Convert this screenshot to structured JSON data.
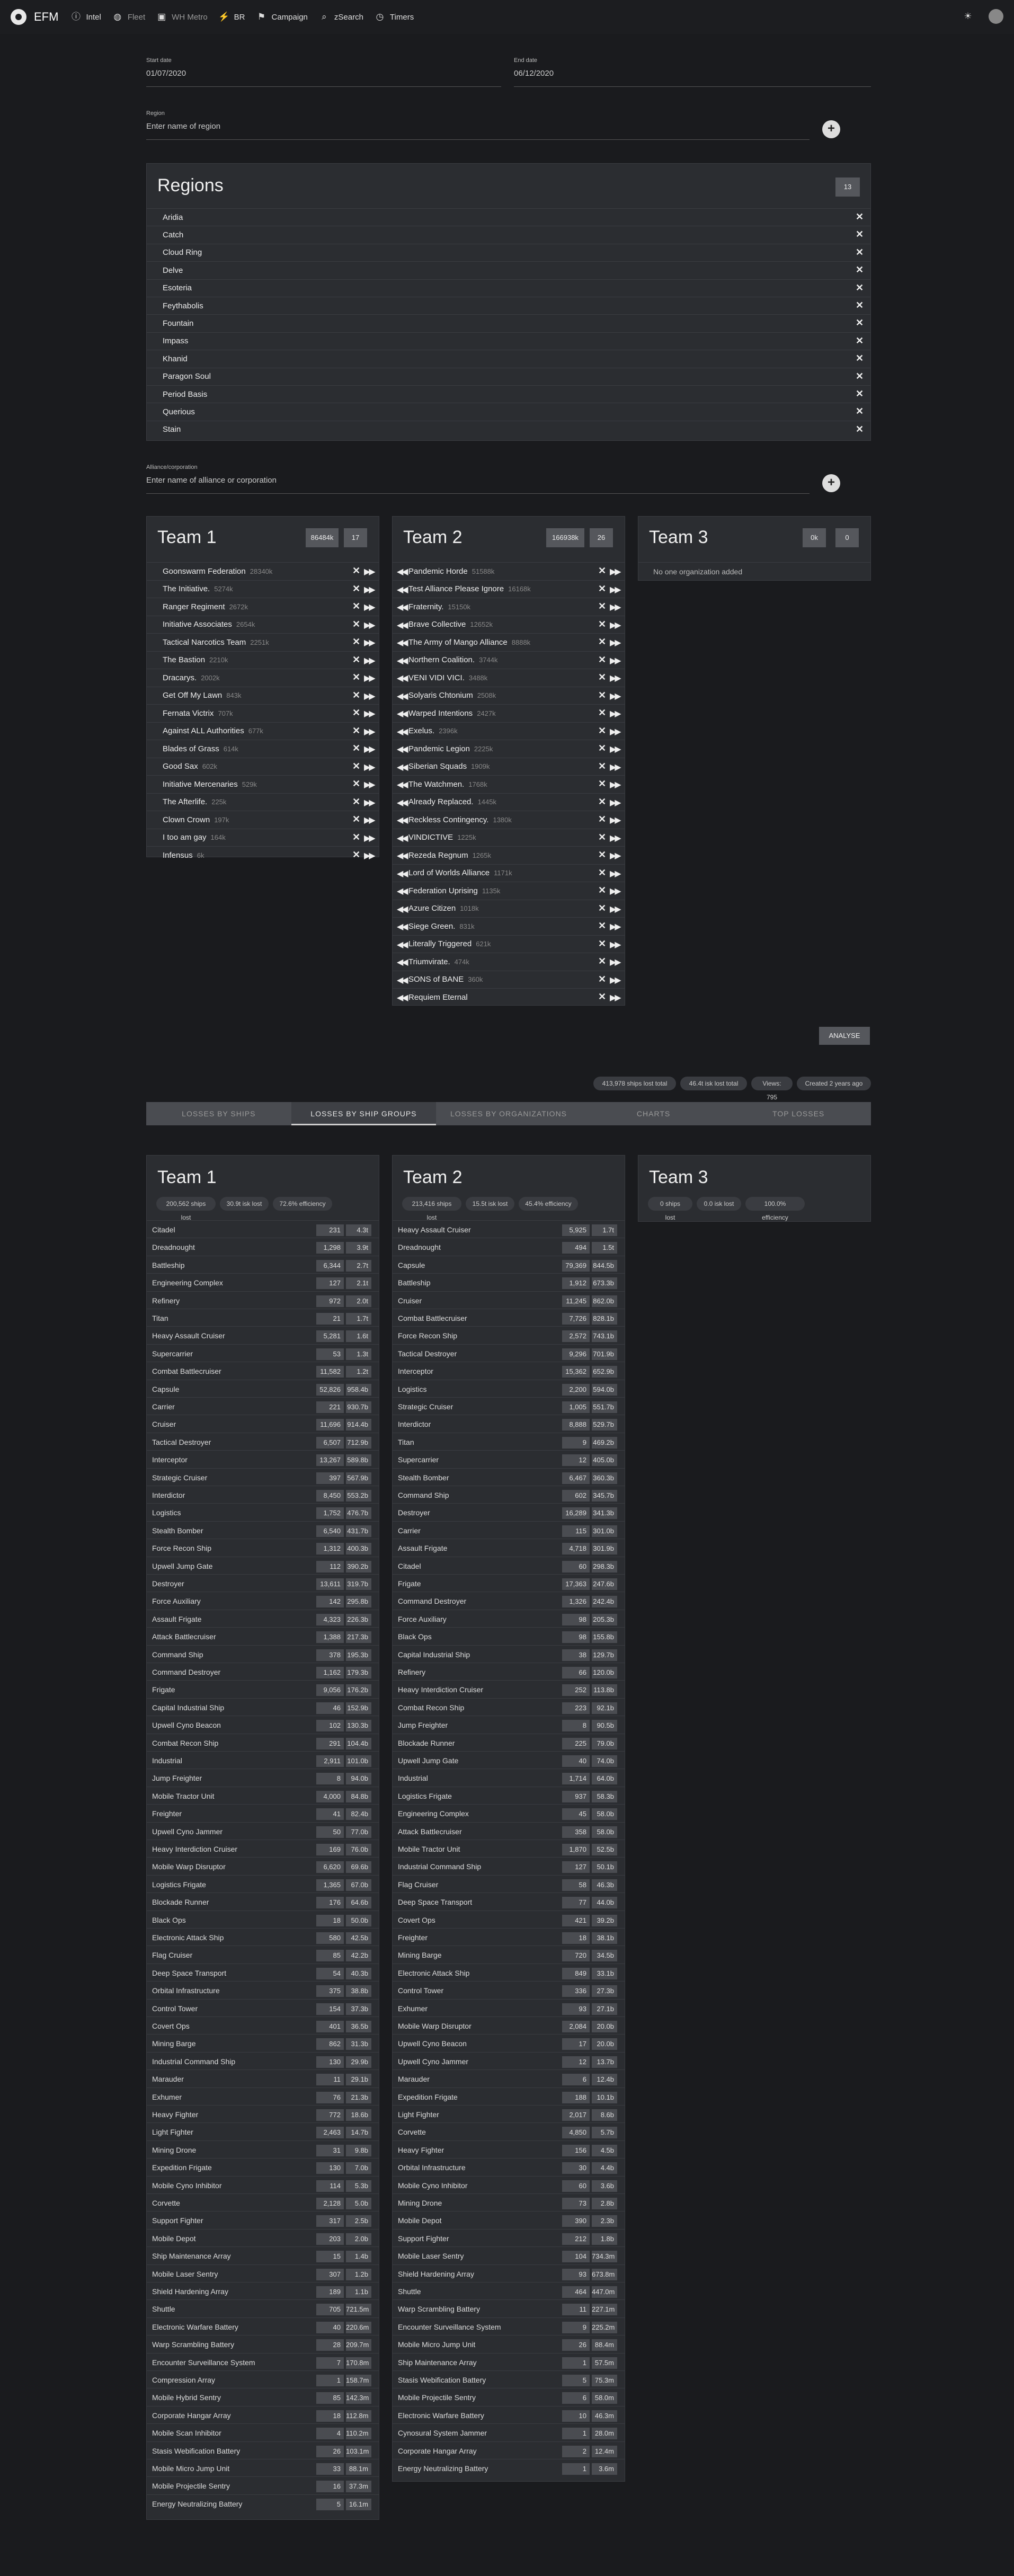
{
  "header": {
    "brand": "EFM",
    "nav": [
      {
        "icon": "info-icon",
        "label": "Intel"
      },
      {
        "icon": "globe-icon",
        "label": "Fleet"
      },
      {
        "icon": "metro-icon",
        "label": "WH Metro"
      },
      {
        "icon": "chart-icon",
        "label": "BR"
      },
      {
        "icon": "flag-icon",
        "label": "Campaign"
      },
      {
        "icon": "search-icon",
        "label": "zSearch"
      },
      {
        "icon": "clock-icon",
        "label": "Timers"
      }
    ]
  },
  "form": {
    "start_label": "Start date",
    "start_value": "01/07/2020",
    "end_label": "End date",
    "end_value": "06/12/2020",
    "region_label": "Region",
    "region_placeholder": "Enter name of region",
    "alliance_label": "Alliance/corporation",
    "alliance_placeholder": "Enter name of alliance or corporation"
  },
  "regions": {
    "title": "Regions",
    "count": "13",
    "items": [
      "Aridia",
      "Catch",
      "Cloud Ring",
      "Delve",
      "Esoteria",
      "Feythabolis",
      "Fountain",
      "Impass",
      "Khanid",
      "Paragon Soul",
      "Period Basis",
      "Querious",
      "Stain"
    ]
  },
  "teams": [
    {
      "title": "Team 1",
      "chip1": "86484k",
      "chip2": "17",
      "members": [
        [
          "Goonswarm Federation",
          "28340k"
        ],
        [
          "The Initiative.",
          "5274k"
        ],
        [
          "Ranger Regiment",
          "2672k"
        ],
        [
          "Initiative Associates",
          "2654k"
        ],
        [
          "Tactical Narcotics Team",
          "2251k"
        ],
        [
          "The Bastion",
          "2210k"
        ],
        [
          "Dracarys.",
          "2002k"
        ],
        [
          "Get Off My Lawn",
          "843k"
        ],
        [
          "Fernata Victrix",
          "707k"
        ],
        [
          "Against ALL Authorities",
          "677k"
        ],
        [
          "Blades of Grass",
          "614k"
        ],
        [
          "Good Sax",
          "602k"
        ],
        [
          "Initiative Mercenaries",
          "529k"
        ],
        [
          "The Afterlife.",
          "225k"
        ],
        [
          "Clown Crown",
          "197k"
        ],
        [
          "I too am gay",
          "164k"
        ],
        [
          "Infensus",
          "6k"
        ]
      ]
    },
    {
      "title": "Team 2",
      "chip1": "166938k",
      "chip2": "26",
      "members": [
        [
          "Pandemic Horde",
          "51588k"
        ],
        [
          "Test Alliance Please Ignore",
          "16168k"
        ],
        [
          "Fraternity.",
          "15150k"
        ],
        [
          "Brave Collective",
          "12652k"
        ],
        [
          "The Army of Mango Alliance",
          "8888k"
        ],
        [
          "Northern Coalition.",
          "3744k"
        ],
        [
          "VENI VIDI VICI.",
          "3488k"
        ],
        [
          "Solyaris Chtonium",
          "2508k"
        ],
        [
          "Warped Intentions",
          "2427k"
        ],
        [
          "Exelus.",
          "2396k"
        ],
        [
          "Pandemic Legion",
          "2225k"
        ],
        [
          "Siberian Squads",
          "1909k"
        ],
        [
          "The Watchmen.",
          "1768k"
        ],
        [
          "Already Replaced.",
          "1445k"
        ],
        [
          "Reckless Contingency.",
          "1380k"
        ],
        [
          "VINDICTIVE",
          "1225k"
        ],
        [
          "Rezeda Regnum",
          "1265k"
        ],
        [
          "Lord of Worlds Alliance",
          "1171k"
        ],
        [
          "Federation Uprising",
          "1135k"
        ],
        [
          "Azure Citizen",
          "1018k"
        ],
        [
          "Siege Green.",
          "831k"
        ],
        [
          "Literally Triggered",
          "621k"
        ],
        [
          "Triumvirate.",
          "474k"
        ],
        [
          "SONS of BANE",
          "360k"
        ],
        [
          "Requiem Eternal",
          ""
        ]
      ]
    },
    {
      "title": "Team 3",
      "chip1": "0k",
      "chip2": "0",
      "empty": "No one organization added"
    }
  ],
  "analyse_label": "ANALYSE",
  "stats": [
    "413,978 ships lost total",
    "46.4t isk lost total",
    "Views: 795",
    "Created 2 years ago"
  ],
  "tabs": [
    "LOSSES BY SHIPS",
    "LOSSES BY SHIP GROUPS",
    "LOSSES BY ORGANIZATIONS",
    "CHARTS",
    "TOP LOSSES"
  ],
  "losses": [
    {
      "title": "Team 1",
      "badges": [
        "200,562 ships lost",
        "30.9t isk lost",
        "72.6% efficiency"
      ],
      "rows": [
        [
          "Citadel",
          "231",
          "4.3t"
        ],
        [
          "Dreadnought",
          "1,298",
          "3.9t"
        ],
        [
          "Battleship",
          "6,344",
          "2.7t"
        ],
        [
          "Engineering Complex",
          "127",
          "2.1t"
        ],
        [
          "Refinery",
          "972",
          "2.0t"
        ],
        [
          "Titan",
          "21",
          "1.7t"
        ],
        [
          "Heavy Assault Cruiser",
          "5,281",
          "1.6t"
        ],
        [
          "Supercarrier",
          "53",
          "1.3t"
        ],
        [
          "Combat Battlecruiser",
          "11,582",
          "1.2t"
        ],
        [
          "Capsule",
          "52,826",
          "958.4b"
        ],
        [
          "Carrier",
          "221",
          "930.7b"
        ],
        [
          "Cruiser",
          "11,696",
          "914.4b"
        ],
        [
          "Tactical Destroyer",
          "6,507",
          "712.9b"
        ],
        [
          "Interceptor",
          "13,267",
          "589.8b"
        ],
        [
          "Strategic Cruiser",
          "397",
          "567.9b"
        ],
        [
          "Interdictor",
          "8,450",
          "553.2b"
        ],
        [
          "Logistics",
          "1,752",
          "476.7b"
        ],
        [
          "Stealth Bomber",
          "6,540",
          "431.7b"
        ],
        [
          "Force Recon Ship",
          "1,312",
          "400.3b"
        ],
        [
          "Upwell Jump Gate",
          "112",
          "390.2b"
        ],
        [
          "Destroyer",
          "13,611",
          "319.7b"
        ],
        [
          "Force Auxiliary",
          "142",
          "295.8b"
        ],
        [
          "Assault Frigate",
          "4,323",
          "226.3b"
        ],
        [
          "Attack Battlecruiser",
          "1,388",
          "217.3b"
        ],
        [
          "Command Ship",
          "378",
          "195.3b"
        ],
        [
          "Command Destroyer",
          "1,162",
          "179.3b"
        ],
        [
          "Frigate",
          "9,056",
          "176.2b"
        ],
        [
          "Capital Industrial Ship",
          "46",
          "152.9b"
        ],
        [
          "Upwell Cyno Beacon",
          "102",
          "130.3b"
        ],
        [
          "Combat Recon Ship",
          "291",
          "104.4b"
        ],
        [
          "Industrial",
          "2,911",
          "101.0b"
        ],
        [
          "Jump Freighter",
          "8",
          "94.0b"
        ],
        [
          "Mobile Tractor Unit",
          "4,000",
          "84.8b"
        ],
        [
          "Freighter",
          "41",
          "82.4b"
        ],
        [
          "Upwell Cyno Jammer",
          "50",
          "77.0b"
        ],
        [
          "Heavy Interdiction Cruiser",
          "169",
          "76.0b"
        ],
        [
          "Mobile Warp Disruptor",
          "6,620",
          "69.6b"
        ],
        [
          "Logistics Frigate",
          "1,365",
          "67.0b"
        ],
        [
          "Blockade Runner",
          "176",
          "64.6b"
        ],
        [
          "Black Ops",
          "18",
          "50.0b"
        ],
        [
          "Electronic Attack Ship",
          "580",
          "42.5b"
        ],
        [
          "Flag Cruiser",
          "85",
          "42.2b"
        ],
        [
          "Deep Space Transport",
          "54",
          "40.3b"
        ],
        [
          "Orbital Infrastructure",
          "375",
          "38.8b"
        ],
        [
          "Control Tower",
          "154",
          "37.3b"
        ],
        [
          "Covert Ops",
          "401",
          "36.5b"
        ],
        [
          "Mining Barge",
          "862",
          "31.3b"
        ],
        [
          "Industrial Command Ship",
          "130",
          "29.9b"
        ],
        [
          "Marauder",
          "11",
          "29.1b"
        ],
        [
          "Exhumer",
          "76",
          "21.3b"
        ],
        [
          "Heavy Fighter",
          "772",
          "18.6b"
        ],
        [
          "Light Fighter",
          "2,463",
          "14.7b"
        ],
        [
          "Mining Drone",
          "31",
          "9.8b"
        ],
        [
          "Expedition Frigate",
          "130",
          "7.0b"
        ],
        [
          "Mobile Cyno Inhibitor",
          "114",
          "5.3b"
        ],
        [
          "Corvette",
          "2,128",
          "5.0b"
        ],
        [
          "Support Fighter",
          "317",
          "2.5b"
        ],
        [
          "Mobile Depot",
          "203",
          "2.0b"
        ],
        [
          "Ship Maintenance Array",
          "15",
          "1.4b"
        ],
        [
          "Mobile Laser Sentry",
          "307",
          "1.2b"
        ],
        [
          "Shield Hardening Array",
          "189",
          "1.1b"
        ],
        [
          "Shuttle",
          "705",
          "721.5m"
        ],
        [
          "Electronic Warfare Battery",
          "40",
          "220.6m"
        ],
        [
          "Warp Scrambling Battery",
          "28",
          "209.7m"
        ],
        [
          "Encounter Surveillance System",
          "7",
          "170.8m"
        ],
        [
          "Compression Array",
          "1",
          "158.7m"
        ],
        [
          "Mobile Hybrid Sentry",
          "85",
          "142.3m"
        ],
        [
          "Corporate Hangar Array",
          "18",
          "112.8m"
        ],
        [
          "Mobile Scan Inhibitor",
          "4",
          "110.2m"
        ],
        [
          "Stasis Webification Battery",
          "26",
          "103.1m"
        ],
        [
          "Mobile Micro Jump Unit",
          "33",
          "88.1m"
        ],
        [
          "Mobile Projectile Sentry",
          "16",
          "37.3m"
        ],
        [
          "Energy Neutralizing Battery",
          "5",
          "16.1m"
        ]
      ]
    },
    {
      "title": "Team 2",
      "badges": [
        "213,416 ships lost",
        "15.5t isk lost",
        "45.4% efficiency"
      ],
      "rows": [
        [
          "Heavy Assault Cruiser",
          "5,925",
          "1.7t"
        ],
        [
          "Dreadnought",
          "494",
          "1.5t"
        ],
        [
          "Capsule",
          "79,369",
          "844.5b"
        ],
        [
          "Battleship",
          "1,912",
          "673.3b"
        ],
        [
          "Cruiser",
          "11,245",
          "862.0b"
        ],
        [
          "Combat Battlecruiser",
          "7,726",
          "828.1b"
        ],
        [
          "Force Recon Ship",
          "2,572",
          "743.1b"
        ],
        [
          "Tactical Destroyer",
          "9,296",
          "701.9b"
        ],
        [
          "Interceptor",
          "15,362",
          "652.9b"
        ],
        [
          "Logistics",
          "2,200",
          "594.0b"
        ],
        [
          "Strategic Cruiser",
          "1,005",
          "551.7b"
        ],
        [
          "Interdictor",
          "8,888",
          "529.7b"
        ],
        [
          "Titan",
          "9",
          "469.2b"
        ],
        [
          "Supercarrier",
          "12",
          "405.0b"
        ],
        [
          "Stealth Bomber",
          "6,467",
          "360.3b"
        ],
        [
          "Command Ship",
          "602",
          "345.7b"
        ],
        [
          "Destroyer",
          "16,289",
          "341.3b"
        ],
        [
          "Carrier",
          "115",
          "301.0b"
        ],
        [
          "Assault Frigate",
          "4,718",
          "301.9b"
        ],
        [
          "Citadel",
          "60",
          "298.3b"
        ],
        [
          "Frigate",
          "17,363",
          "247.6b"
        ],
        [
          "Command Destroyer",
          "1,326",
          "242.4b"
        ],
        [
          "Force Auxiliary",
          "98",
          "205.3b"
        ],
        [
          "Black Ops",
          "98",
          "155.8b"
        ],
        [
          "Capital Industrial Ship",
          "38",
          "129.7b"
        ],
        [
          "Refinery",
          "66",
          "120.0b"
        ],
        [
          "Heavy Interdiction Cruiser",
          "252",
          "113.8b"
        ],
        [
          "Combat Recon Ship",
          "223",
          "92.1b"
        ],
        [
          "Jump Freighter",
          "8",
          "90.5b"
        ],
        [
          "Blockade Runner",
          "225",
          "79.0b"
        ],
        [
          "Upwell Jump Gate",
          "40",
          "74.0b"
        ],
        [
          "Industrial",
          "1,714",
          "64.0b"
        ],
        [
          "Logistics Frigate",
          "937",
          "58.3b"
        ],
        [
          "Engineering Complex",
          "45",
          "58.0b"
        ],
        [
          "Attack Battlecruiser",
          "358",
          "58.0b"
        ],
        [
          "Mobile Tractor Unit",
          "1,870",
          "52.5b"
        ],
        [
          "Industrial Command Ship",
          "127",
          "50.1b"
        ],
        [
          "Flag Cruiser",
          "58",
          "46.3b"
        ],
        [
          "Deep Space Transport",
          "77",
          "44.0b"
        ],
        [
          "Covert Ops",
          "421",
          "39.2b"
        ],
        [
          "Freighter",
          "18",
          "38.1b"
        ],
        [
          "Mining Barge",
          "720",
          "34.5b"
        ],
        [
          "Electronic Attack Ship",
          "849",
          "33.1b"
        ],
        [
          "Control Tower",
          "336",
          "27.3b"
        ],
        [
          "Exhumer",
          "93",
          "27.1b"
        ],
        [
          "Mobile Warp Disruptor",
          "2,084",
          "20.0b"
        ],
        [
          "Upwell Cyno Beacon",
          "17",
          "20.0b"
        ],
        [
          "Upwell Cyno Jammer",
          "12",
          "13.7b"
        ],
        [
          "Marauder",
          "6",
          "12.4b"
        ],
        [
          "Expedition Frigate",
          "188",
          "10.1b"
        ],
        [
          "Light Fighter",
          "2,017",
          "8.6b"
        ],
        [
          "Corvette",
          "4,850",
          "5.7b"
        ],
        [
          "Heavy Fighter",
          "156",
          "4.5b"
        ],
        [
          "Orbital Infrastructure",
          "30",
          "4.4b"
        ],
        [
          "Mobile Cyno Inhibitor",
          "60",
          "3.6b"
        ],
        [
          "Mining Drone",
          "73",
          "2.8b"
        ],
        [
          "Mobile Depot",
          "390",
          "2.3b"
        ],
        [
          "Support Fighter",
          "212",
          "1.8b"
        ],
        [
          "Mobile Laser Sentry",
          "104",
          "734.3m"
        ],
        [
          "Shield Hardening Array",
          "93",
          "673.8m"
        ],
        [
          "Shuttle",
          "464",
          "447.0m"
        ],
        [
          "Warp Scrambling Battery",
          "11",
          "227.1m"
        ],
        [
          "Encounter Surveillance System",
          "9",
          "225.2m"
        ],
        [
          "Mobile Micro Jump Unit",
          "26",
          "88.4m"
        ],
        [
          "Ship Maintenance Array",
          "1",
          "57.5m"
        ],
        [
          "Stasis Webification Battery",
          "5",
          "75.3m"
        ],
        [
          "Mobile Projectile Sentry",
          "6",
          "58.0m"
        ],
        [
          "Electronic Warfare Battery",
          "10",
          "46.3m"
        ],
        [
          "Cynosural System Jammer",
          "1",
          "28.0m"
        ],
        [
          "Corporate Hangar Array",
          "2",
          "12.4m"
        ],
        [
          "Energy Neutralizing Battery",
          "1",
          "3.6m"
        ]
      ]
    },
    {
      "title": "Team 3",
      "badges": [
        "0 ships lost",
        "0.0 isk lost",
        "100.0% efficiency"
      ],
      "rows": []
    }
  ]
}
